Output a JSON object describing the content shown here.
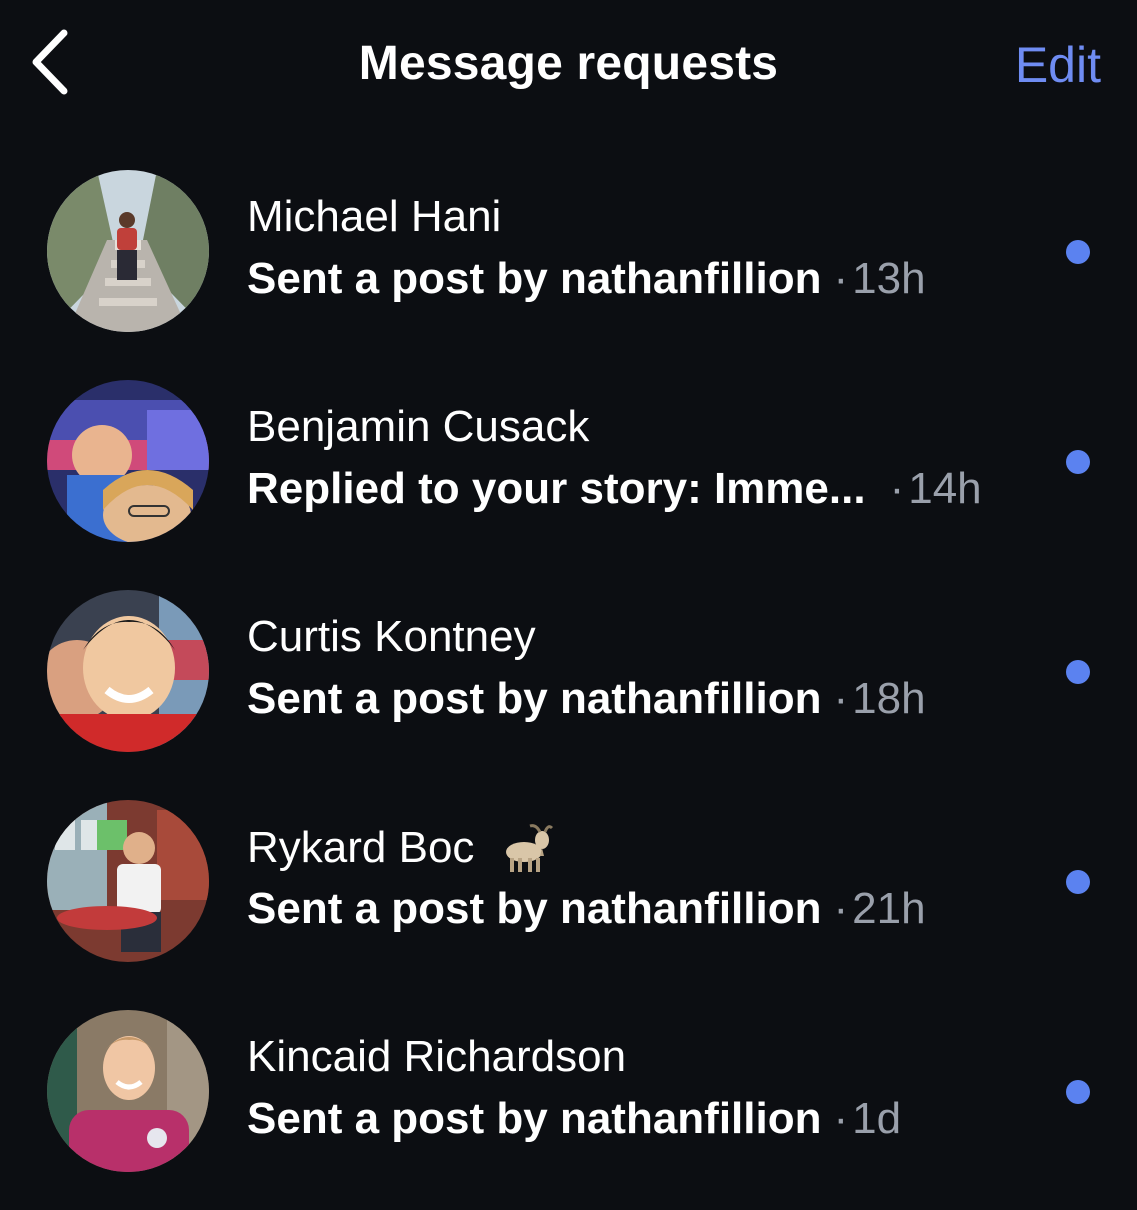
{
  "header": {
    "title": "Message requests",
    "edit_label": "Edit"
  },
  "requests": [
    {
      "name": "Michael Hani",
      "preview": "Sent a post by nathanfillion",
      "time": "13h",
      "unread": true
    },
    {
      "name": "Benjamin Cusack",
      "preview": "Replied to your story: Imme...",
      "time": "14h",
      "unread": true
    },
    {
      "name": "Curtis Kontney",
      "preview": "Sent a post by nathanfillion",
      "time": "18h",
      "unread": true
    },
    {
      "name": "Rykard Boc",
      "name_emoji": "goat-emoji",
      "preview": "Sent a post by nathanfillion",
      "time": "21h",
      "unread": true
    },
    {
      "name": "Kincaid Richardson",
      "preview": "Sent a post by nathanfillion",
      "time": "1d",
      "unread": true
    }
  ],
  "separator": "·",
  "colors": {
    "background": "#0c0e12",
    "accent": "#6f8cf2",
    "unread_dot": "#5b82f0",
    "muted": "#9aa0ab"
  }
}
